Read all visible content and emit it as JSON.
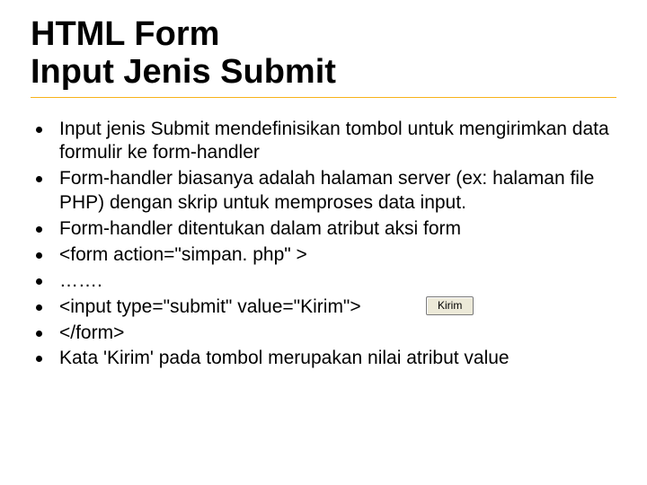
{
  "title": {
    "line1": "HTML Form",
    "line2": "Input Jenis Submit"
  },
  "bullets": [
    {
      "text": "Input jenis Submit mendefinisikan tombol untuk mengirimkan data formulir ke form-handler"
    },
    {
      "text": "Form-handler biasanya adalah halaman server (ex: halaman file PHP) dengan skrip untuk memproses data input."
    },
    {
      "text": "Form-handler ditentukan dalam atribut aksi form"
    },
    {
      "text": "<form action=\"simpan. php\" >"
    },
    {
      "text": " ……."
    },
    {
      "text": "  <input type=\"submit\" value=\"Kirim\">",
      "button": "Kirim"
    },
    {
      "text": "</form>"
    },
    {
      "text": "Kata 'Kirim' pada tombol merupakan nilai atribut value"
    }
  ]
}
